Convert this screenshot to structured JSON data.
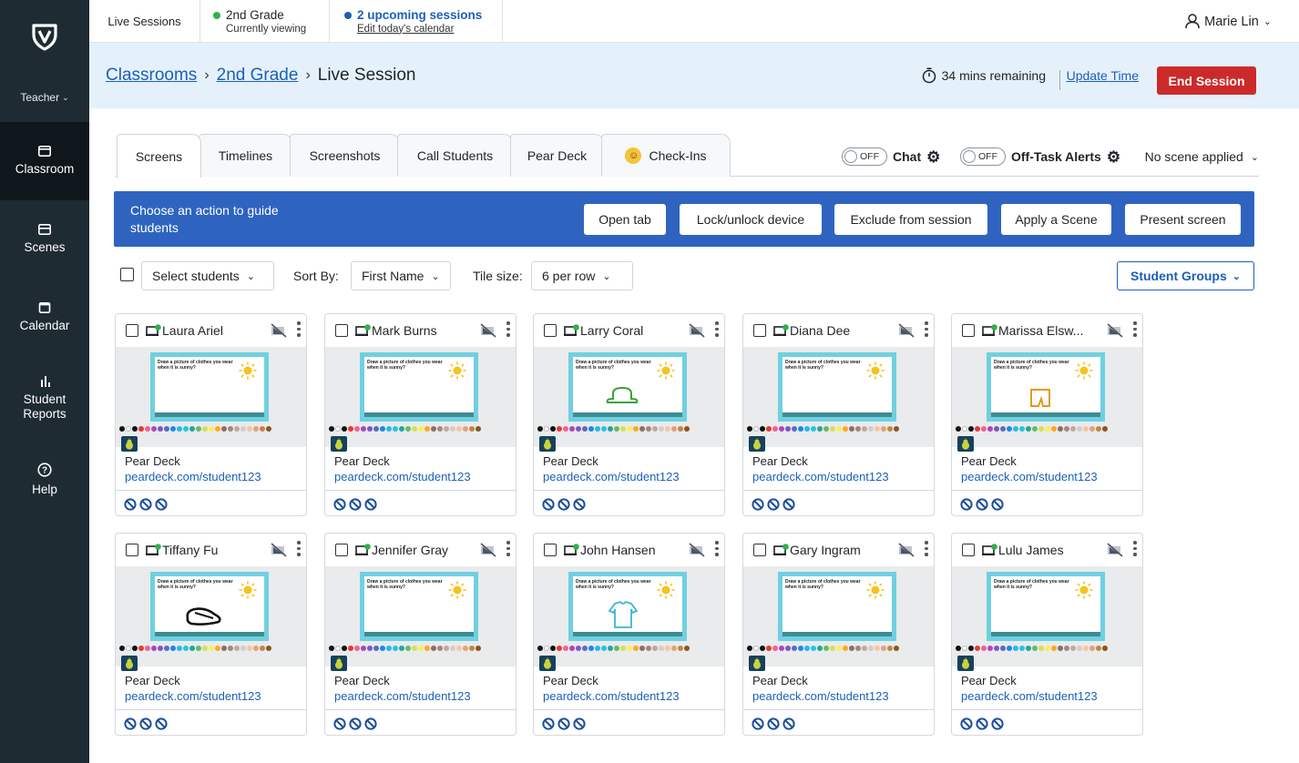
{
  "sidebar": {
    "role_label": "Teacher",
    "items": [
      {
        "label": "Classroom",
        "icon": "classroom-icon",
        "active": true
      },
      {
        "label": "Scenes",
        "icon": "scenes-icon",
        "active": false
      },
      {
        "label": "Calendar",
        "icon": "calendar-icon",
        "active": false
      },
      {
        "label": "Student\nReports",
        "icon": "bar-chart-icon",
        "active": false
      },
      {
        "label": "Help",
        "icon": "help-icon",
        "active": false
      }
    ]
  },
  "topbar": {
    "live_sessions": "Live Sessions",
    "grade_title": "2nd Grade",
    "grade_sub": "Currently viewing",
    "upcoming_title": "2 upcoming sessions",
    "upcoming_link": "Edit today's calendar",
    "user_name": "Marie Lin"
  },
  "breadcrumb": {
    "root": "Classrooms",
    "class": "2nd Grade",
    "current": "Live Session",
    "sep": "›"
  },
  "session": {
    "time_remaining": "34 mins remaining",
    "update_time": "Update Time",
    "end_session": "End Session"
  },
  "tabs": [
    {
      "label": "Screens",
      "active": true
    },
    {
      "label": "Timelines",
      "active": false
    },
    {
      "label": "Screenshots",
      "active": false
    },
    {
      "label": "Call Students",
      "active": false
    },
    {
      "label": "Pear Deck",
      "active": false
    },
    {
      "label": "Check-Ins",
      "active": false
    }
  ],
  "toggles": {
    "chat_label": "Chat",
    "chat_state": "OFF",
    "offtask_label": "Off-Task Alerts",
    "offtask_state": "OFF",
    "scene_dropdown": "No scene applied"
  },
  "actions": {
    "prompt": "Choose an action to guide students",
    "buttons": [
      "Open tab",
      "Lock/unlock device",
      "Exclude from session",
      "Apply a Scene",
      "Present screen"
    ]
  },
  "controls": {
    "select_students": "Select students",
    "sort_by_label": "Sort By:",
    "sort_by_value": "First Name",
    "tile_size_label": "Tile size:",
    "tile_size_value": "6 per row",
    "student_groups": "Student Groups"
  },
  "slide_prompt": "Draw a picture of clothes you wear when it is sunny?",
  "students": [
    {
      "name": "Laura Ariel",
      "app": "Pear Deck",
      "url": "peardeck.com/student123",
      "drawing": "none"
    },
    {
      "name": "Mark Burns",
      "app": "Pear Deck",
      "url": "peardeck.com/student123",
      "drawing": "none"
    },
    {
      "name": "Larry Coral",
      "app": "Pear Deck",
      "url": "peardeck.com/student123",
      "drawing": "hat"
    },
    {
      "name": "Diana Dee",
      "app": "Pear Deck",
      "url": "peardeck.com/student123",
      "drawing": "none"
    },
    {
      "name": "Marissa Elsw...",
      "app": "Pear Deck",
      "url": "peardeck.com/student123",
      "drawing": "shorts"
    },
    {
      "name": "Tiffany Fu",
      "app": "Pear Deck",
      "url": "peardeck.com/student123",
      "drawing": "shoe"
    },
    {
      "name": "Jennifer Gray",
      "app": "Pear Deck",
      "url": "peardeck.com/student123",
      "drawing": "none"
    },
    {
      "name": "John Hansen",
      "app": "Pear Deck",
      "url": "peardeck.com/student123",
      "drawing": "shirt"
    },
    {
      "name": "Gary Ingram",
      "app": "Pear Deck",
      "url": "peardeck.com/student123",
      "drawing": "none"
    },
    {
      "name": "Lulu James",
      "app": "Pear Deck",
      "url": "peardeck.com/student123",
      "drawing": "none"
    }
  ],
  "colors": {
    "sidebar": "#1f2b33",
    "accent_blue": "#1d5fb8",
    "banner_blue": "#2e64c0",
    "end_red": "#cc2a2a",
    "online_green": "#2fb24a"
  }
}
